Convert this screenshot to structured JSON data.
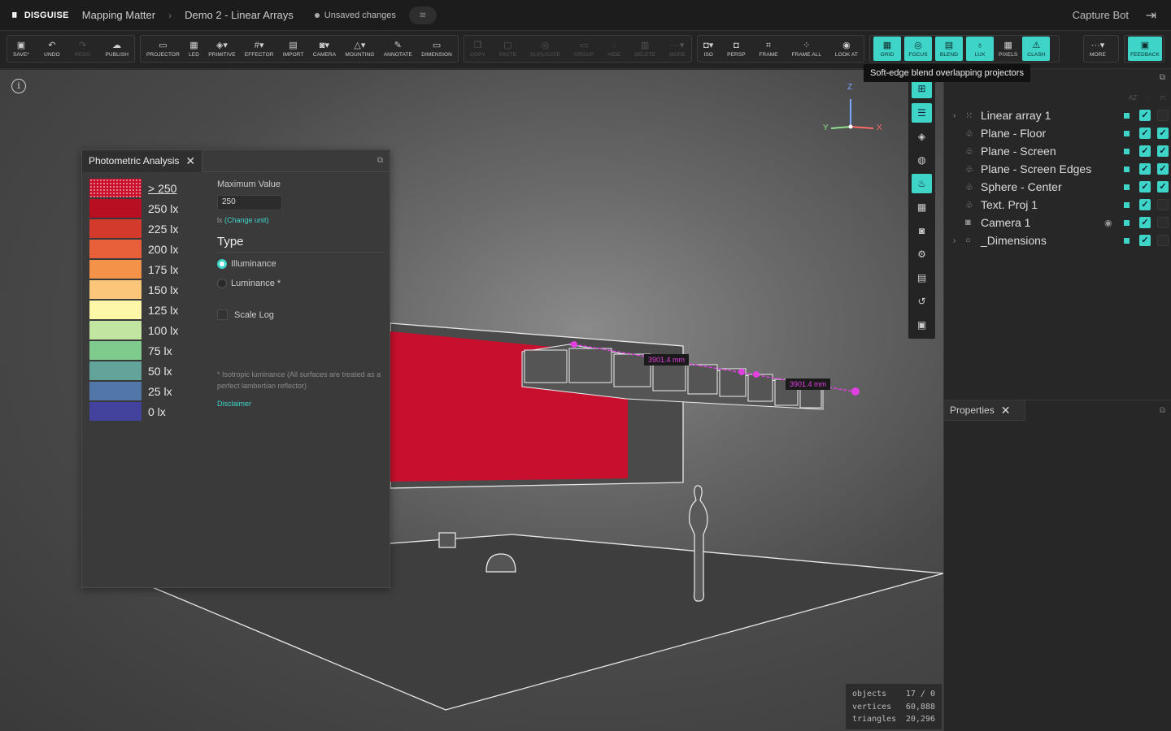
{
  "topbar": {
    "brand": "DISGUISE",
    "project": "Mapping Matter",
    "doc": "Demo 2 - Linear Arrays",
    "unsaved": "Unsaved changes",
    "user": "Capture Bot"
  },
  "toolbar": {
    "file": [
      {
        "label": "SAVE*",
        "icon": "▣"
      },
      {
        "label": "UNDO",
        "icon": "↶"
      },
      {
        "label": "REDO",
        "icon": "↷"
      },
      {
        "label": "PUBLISH",
        "icon": "☁"
      }
    ],
    "create": [
      {
        "label": "PROJECTOR",
        "icon": "▭"
      },
      {
        "label": "LED",
        "icon": "▦"
      },
      {
        "label": "PRIMITIVE",
        "icon": "◈▾"
      },
      {
        "label": "EFFECTOR",
        "icon": "#▾"
      },
      {
        "label": "IMPORT",
        "icon": "▤"
      },
      {
        "label": "CAMERA",
        "icon": "◙▾"
      },
      {
        "label": "MOUNTING",
        "icon": "△▾"
      },
      {
        "label": "ANNOTATE",
        "icon": "✎"
      },
      {
        "label": "DIMENSION",
        "icon": "▭"
      }
    ],
    "edit": [
      {
        "label": "COPY",
        "icon": "❐"
      },
      {
        "label": "PASTE",
        "icon": "▢"
      },
      {
        "label": "DUPLICATE",
        "icon": "◎"
      },
      {
        "label": "GROUP",
        "icon": "▭"
      },
      {
        "label": "HIDE",
        "icon": "◌"
      },
      {
        "label": "DELETE",
        "icon": "▥"
      },
      {
        "label": "MORE",
        "icon": "···▾"
      }
    ],
    "view": [
      {
        "label": "ISO",
        "icon": "◘▾"
      },
      {
        "label": "PERSP",
        "icon": "◘"
      },
      {
        "label": "FRAME",
        "icon": "⌗"
      },
      {
        "label": "FRAME ALL",
        "icon": "⁘"
      },
      {
        "label": "LOOK AT",
        "icon": "◉"
      }
    ],
    "toggles": [
      {
        "label": "GRID",
        "icon": "▦",
        "active": true
      },
      {
        "label": "FOCUS",
        "icon": "◎",
        "active": true
      },
      {
        "label": "BLEND",
        "icon": "▤",
        "active": true
      },
      {
        "label": "LUX",
        "icon": "♁",
        "active": true
      },
      {
        "label": "PIXELS",
        "icon": "▦",
        "active": false
      },
      {
        "label": "CLASH",
        "icon": "⚠",
        "active": true
      }
    ],
    "more": "MORE",
    "feedback": "FEEDBACK"
  },
  "tooltip": "Soft-edge blend overlapping projectors",
  "photometric": {
    "title": "Photometric Analysis",
    "legend": [
      {
        "label": "> 250",
        "color": "#c8102e",
        "dotted": true
      },
      {
        "label": "250 lx",
        "color": "#b80f22"
      },
      {
        "label": "225 lx",
        "color": "#d33a2c"
      },
      {
        "label": "200 lx",
        "color": "#e8603a"
      },
      {
        "label": "175 lx",
        "color": "#f5924a"
      },
      {
        "label": "150 lx",
        "color": "#fbc57a"
      },
      {
        "label": "125 lx",
        "color": "#fdf7a8"
      },
      {
        "label": "100 lx",
        "color": "#c2e6a2"
      },
      {
        "label": "75 lx",
        "color": "#7fcb8e"
      },
      {
        "label": "50 lx",
        "color": "#62a49a"
      },
      {
        "label": "25 lx",
        "color": "#5176a8"
      },
      {
        "label": "0 lx",
        "color": "#43439e"
      }
    ],
    "max_label": "Maximum Value",
    "max_value": "250",
    "unit": "lx",
    "change_unit": "(Change unit)",
    "type_heading": "Type",
    "opt_illuminance": "Illuminance",
    "opt_luminance": "Luminance *",
    "scale_log": "Scale Log",
    "note": "* Isotropic luminance (All surfaces are treated as a perfect lambertian reflector)",
    "disclaimer": "Disclaimer"
  },
  "viewport": {
    "dim1": "3901.4 mm",
    "dim2": "3901.4 mm",
    "axis_x": "X",
    "axis_y": "Y",
    "axis_z": "Z",
    "stats": [
      {
        "k": "objects",
        "v": "17 / 0"
      },
      {
        "k": "vertices",
        "v": "60,888"
      },
      {
        "k": "triangles",
        "v": "20,296"
      }
    ]
  },
  "scene_tree": {
    "sort": "AZ",
    "items": [
      {
        "name": "Linear array 1",
        "icon": "⁙",
        "expand": true,
        "eye": false,
        "c1": true,
        "c2": false
      },
      {
        "name": "Plane - Floor",
        "icon": "♧",
        "expand": false,
        "eye": false,
        "c1": true,
        "c2": true
      },
      {
        "name": "Plane - Screen",
        "icon": "♧",
        "expand": false,
        "eye": false,
        "c1": true,
        "c2": true
      },
      {
        "name": "Plane - Screen Edges",
        "icon": "♧",
        "expand": false,
        "eye": false,
        "c1": true,
        "c2": true
      },
      {
        "name": "Sphere - Center",
        "icon": "♧",
        "expand": false,
        "eye": false,
        "c1": true,
        "c2": true
      },
      {
        "name": "Text. Proj 1",
        "icon": "♧",
        "expand": false,
        "eye": false,
        "c1": true,
        "c2": false
      },
      {
        "name": "Camera 1",
        "icon": "◙",
        "expand": false,
        "eye": true,
        "c1": true,
        "c2": false
      },
      {
        "name": "_Dimensions",
        "icon": "○",
        "expand": true,
        "eye": false,
        "c1": true,
        "c2": false
      }
    ]
  },
  "properties": {
    "title": "Properties"
  }
}
